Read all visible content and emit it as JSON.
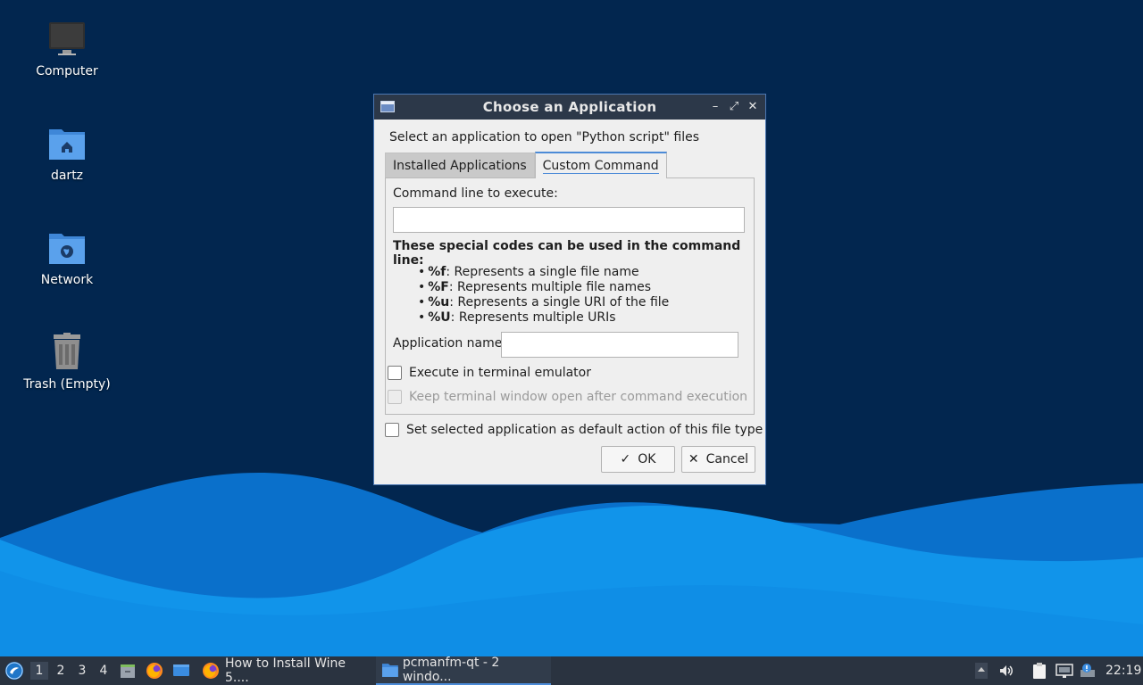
{
  "desktop": {
    "icons": [
      {
        "label": "Computer",
        "icon": "monitor-icon"
      },
      {
        "label": "dartz",
        "icon": "home-folder-icon"
      },
      {
        "label": "Network",
        "icon": "network-folder-icon"
      },
      {
        "label": "Trash (Empty)",
        "icon": "trash-icon"
      }
    ]
  },
  "dialog": {
    "title": "Choose an Application",
    "prompt": "Select an application to open \"Python script\" files",
    "tabs": [
      {
        "label": "Installed Applications",
        "active": false
      },
      {
        "label": "Custom Command",
        "active": true
      }
    ],
    "command_label": "Command line to execute:",
    "command_value": "",
    "codes_title": "These special codes can be used in the command line:",
    "codes": [
      {
        "code": "%f",
        "desc": ": Represents a single file name"
      },
      {
        "code": "%F",
        "desc": ": Represents multiple file names"
      },
      {
        "code": "%u",
        "desc": ": Represents a single URI of the file"
      },
      {
        "code": "%U",
        "desc": ": Represents multiple URIs"
      }
    ],
    "app_name_label": "Application name:",
    "app_name_value": "",
    "exec_terminal_label": "Execute in terminal emulator",
    "keep_open_label": "Keep terminal window open after command execution",
    "default_action_label": "Set selected application as default action of this file type",
    "ok_label": "OK",
    "cancel_label": "Cancel"
  },
  "taskbar": {
    "workspaces": [
      "1",
      "2",
      "3",
      "4"
    ],
    "active_workspace": "1",
    "tasks": [
      {
        "label": "How to Install Wine 5....",
        "icon": "firefox-icon",
        "active": false
      },
      {
        "label": "pcmanfm-qt - 2 windo...",
        "icon": "folder-icon",
        "active": true
      }
    ],
    "clock": "22:19"
  },
  "colors": {
    "desktop_bg": "#02264f",
    "wave_light": "#0f8de6",
    "wave_dark": "#0a6cc6",
    "taskbar_bg": "#2a3340",
    "titlebar_bg": "#2c3849",
    "accent": "#4c8bd7"
  }
}
